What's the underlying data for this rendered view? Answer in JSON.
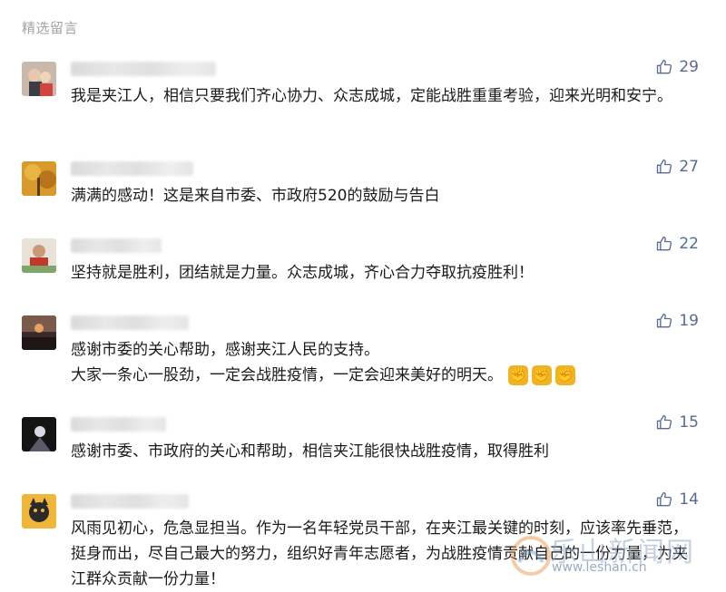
{
  "section_title": "精选留言",
  "comments": [
    {
      "likes": "29",
      "text": "我是夹江人，相信只要我们齐心协力、众志成城，定能战胜重重考验，迎来光明和安宁。"
    },
    {
      "likes": "27",
      "text": "满满的感动！这是来自市委、市政府520的鼓励与告白"
    },
    {
      "likes": "22",
      "text": "坚持就是胜利，团结就是力量。众志成城，齐心合力夺取抗疫胜利！"
    },
    {
      "likes": "19",
      "line1": "感谢市委的关心帮助，感谢夹江人民的支持。",
      "line2": "大家一条心一股劲，一定会战胜疫情，一定会迎来美好的明天。"
    },
    {
      "likes": "15",
      "text": "感谢市委、市政府的关心和帮助，相信夹江能很快战胜疫情，取得胜利"
    },
    {
      "likes": "14",
      "text": "风雨见初心，危急显担当。作为一名年轻党员干部，在夹江最关键的时刻，应该率先垂范，挺身而出，尽自己最大的努力，组织好青年志愿者，为战胜疫情贡献自己的一份力量，为夹江群众贡献一份力量！"
    }
  ],
  "icons": {
    "like": "thumbs-up-icon",
    "fist": "raised-fist-emoji"
  },
  "colors": {
    "link": "#576b95",
    "text": "#1a1a1a",
    "muted": "#a3a3a3"
  },
  "watermark": {
    "cn": "乐山新闻网",
    "url": "www.leshan.cn"
  }
}
